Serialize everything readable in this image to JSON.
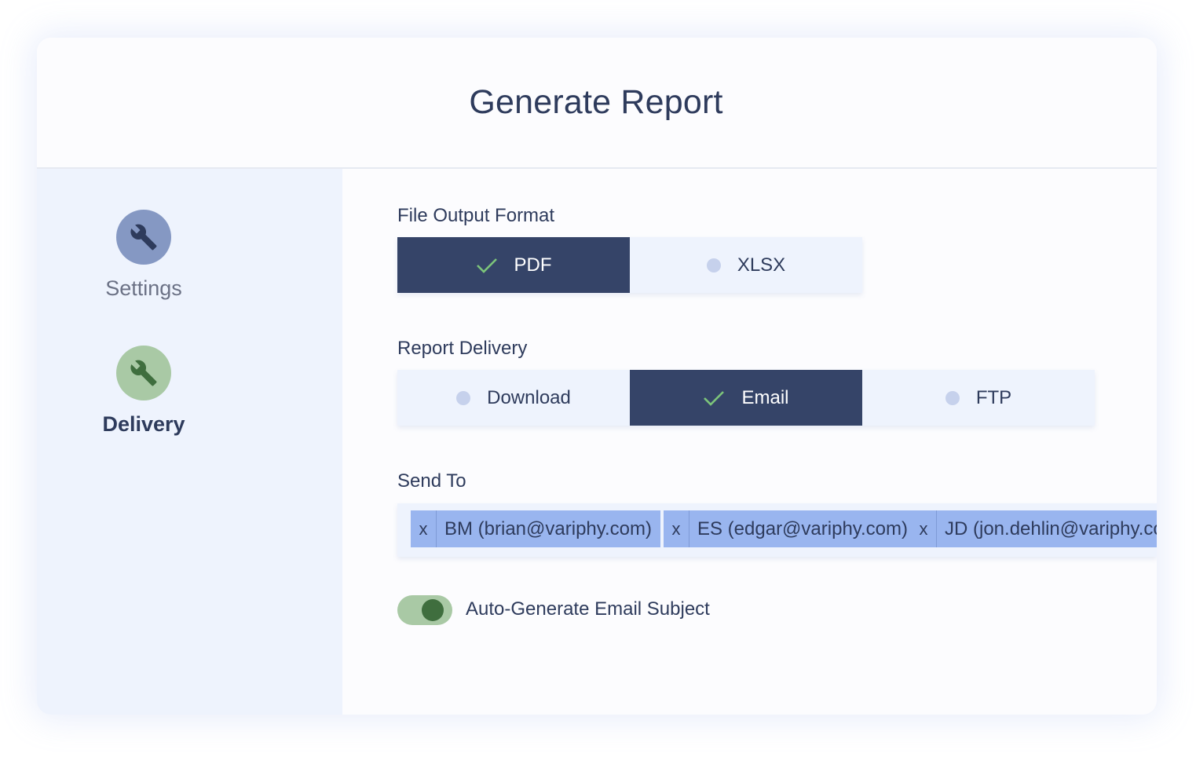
{
  "header": {
    "title": "Generate Report"
  },
  "sidebar": {
    "items": [
      {
        "label": "Settings",
        "icon": "wrench-icon",
        "active": false
      },
      {
        "label": "Delivery",
        "icon": "wrench-icon",
        "active": true
      }
    ]
  },
  "file_output": {
    "label": "File Output Format",
    "options": [
      {
        "label": "PDF",
        "selected": true
      },
      {
        "label": "XLSX",
        "selected": false
      }
    ]
  },
  "report_delivery": {
    "label": "Report Delivery",
    "options": [
      {
        "label": "Download",
        "selected": false
      },
      {
        "label": "Email",
        "selected": true
      },
      {
        "label": "FTP",
        "selected": false
      }
    ]
  },
  "send_to": {
    "label": "Send To",
    "remove_label": "x",
    "recipients": [
      {
        "text": "BM (brian@variphy.com)"
      },
      {
        "text": "ES (edgar@variphy.com)"
      },
      {
        "text": "JD (jon.dehlin@variphy.com)"
      }
    ]
  },
  "auto_subject": {
    "label": "Auto-Generate Email Subject",
    "enabled": true
  },
  "colors": {
    "accent_navy": "#354468",
    "check_green": "#7cc47a",
    "chip_blue": "#99b5ef",
    "toggle_green": "#3f6e3e"
  }
}
